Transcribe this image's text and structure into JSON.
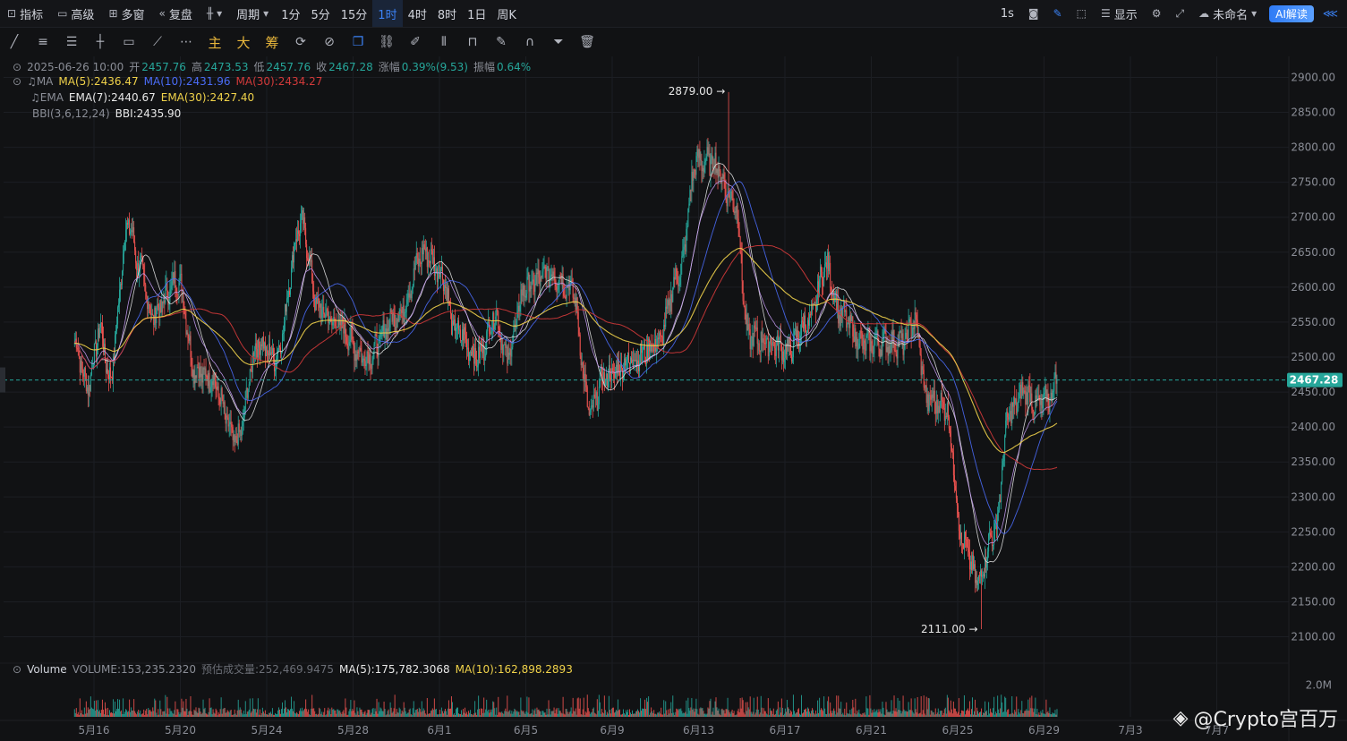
{
  "toolbar": {
    "indicators": "指标",
    "advanced": "高级",
    "multi_window": "多窗",
    "replay": "复盘",
    "period": "周期",
    "timeframes": [
      "1分",
      "5分",
      "15分",
      "1时",
      "4时",
      "8时",
      "1日",
      "周K"
    ],
    "active_timeframe": "1时",
    "interval_1s": "1s",
    "display": "显示",
    "unnamed": "未命名",
    "ai": "AI解读"
  },
  "drawing_tools": {
    "main": "主",
    "big": "大",
    "chip": "筹"
  },
  "legend": {
    "ohlc": {
      "date": "2025-06-26 10:00",
      "open_label": "开",
      "open": "2457.76",
      "high_label": "高",
      "high": "2473.53",
      "low_label": "低",
      "low": "2457.76",
      "close_label": "收",
      "close": "2467.28",
      "change_label": "涨幅",
      "change": "0.39%(9.53)",
      "amp_label": "振幅",
      "amp": "0.64%"
    },
    "ma": {
      "name": "MA",
      "ma5": "MA(5):2436.47",
      "ma10": "MA(10):2431.96",
      "ma30": "MA(30):2434.27"
    },
    "ema": {
      "name": "EMA",
      "ema7": "EMA(7):2440.67",
      "ema30": "EMA(30):2427.40"
    },
    "bbi": {
      "name": "BBI(3,6,12,24)",
      "value": "BBI:2435.90"
    },
    "volume": {
      "name": "Volume",
      "vol": "VOLUME:153,235.2320",
      "est": "预估成交量:252,469.9475",
      "ma5": "MA(5):175,782.3068",
      "ma10": "MA(10):162,898.2893"
    }
  },
  "colors": {
    "up": "#26a69a",
    "down": "#ef5350",
    "ma5": "#f0d24a",
    "ma10": "#4a6cf7",
    "ma30": "#d33a3a",
    "ema": "#e8e8e8",
    "bbi": "#c79df5",
    "bg": "#111214",
    "grid": "#1c1e23",
    "price_tag": "#26a69a"
  },
  "chart_data": {
    "type": "candlestick",
    "interval": "1h",
    "price_axis": {
      "ylim": [
        2070,
        2930
      ],
      "ticks": [
        2100,
        2150,
        2200,
        2250,
        2300,
        2350,
        2400,
        2450,
        2500,
        2550,
        2600,
        2650,
        2700,
        2750,
        2800,
        2850,
        2900
      ]
    },
    "volume_axis": {
      "tick_label": "2.0M",
      "tick_value": 2000000,
      "ymax": 2700000
    },
    "x_tick_labels": [
      "5月16",
      "5月20",
      "5月24",
      "5月28",
      "6月1",
      "6月5",
      "6月9",
      "6月13",
      "6月17",
      "6月21",
      "6月25",
      "6月29",
      "7月3",
      "7月7"
    ],
    "x_days_per_label": 4,
    "series_anchors": [
      {
        "d": 0,
        "p": 2520
      },
      {
        "d": 0.6,
        "p": 2460
      },
      {
        "d": 1.2,
        "p": 2540
      },
      {
        "d": 1.6,
        "p": 2470
      },
      {
        "d": 2.5,
        "p": 2690
      },
      {
        "d": 3.0,
        "p": 2630
      },
      {
        "d": 3.6,
        "p": 2560
      },
      {
        "d": 4.8,
        "p": 2610
      },
      {
        "d": 5.6,
        "p": 2480
      },
      {
        "d": 6.3,
        "p": 2470
      },
      {
        "d": 7.5,
        "p": 2380
      },
      {
        "d": 8.5,
        "p": 2520
      },
      {
        "d": 9.3,
        "p": 2500
      },
      {
        "d": 10.5,
        "p": 2690
      },
      {
        "d": 11.3,
        "p": 2570
      },
      {
        "d": 12.0,
        "p": 2550
      },
      {
        "d": 13.5,
        "p": 2500
      },
      {
        "d": 15.0,
        "p": 2560
      },
      {
        "d": 16.2,
        "p": 2650
      },
      {
        "d": 17.0,
        "p": 2620
      },
      {
        "d": 17.6,
        "p": 2540
      },
      {
        "d": 18.7,
        "p": 2500
      },
      {
        "d": 19.5,
        "p": 2560
      },
      {
        "d": 20.0,
        "p": 2500
      },
      {
        "d": 20.9,
        "p": 2600
      },
      {
        "d": 22.0,
        "p": 2620
      },
      {
        "d": 23.0,
        "p": 2600
      },
      {
        "d": 23.9,
        "p": 2420
      },
      {
        "d": 24.5,
        "p": 2470
      },
      {
        "d": 26.0,
        "p": 2500
      },
      {
        "d": 27.0,
        "p": 2520
      },
      {
        "d": 28.0,
        "p": 2620
      },
      {
        "d": 28.8,
        "p": 2780
      },
      {
        "d": 29.5,
        "p": 2780
      },
      {
        "d": 30.6,
        "p": 2720
      },
      {
        "d": 31.2,
        "p": 2530
      },
      {
        "d": 32.3,
        "p": 2520
      },
      {
        "d": 33.0,
        "p": 2510
      },
      {
        "d": 34.0,
        "p": 2550
      },
      {
        "d": 34.8,
        "p": 2630
      },
      {
        "d": 35.5,
        "p": 2560
      },
      {
        "d": 36.5,
        "p": 2520
      },
      {
        "d": 37.5,
        "p": 2520
      },
      {
        "d": 38.4,
        "p": 2520
      },
      {
        "d": 38.9,
        "p": 2550
      },
      {
        "d": 39.5,
        "p": 2440
      },
      {
        "d": 40.3,
        "p": 2430
      },
      {
        "d": 41.2,
        "p": 2230
      },
      {
        "d": 41.8,
        "p": 2180
      },
      {
        "d": 42.6,
        "p": 2250
      },
      {
        "d": 43.3,
        "p": 2420
      },
      {
        "d": 44.0,
        "p": 2450
      },
      {
        "d": 44.6,
        "p": 2430
      },
      {
        "d": 45.1,
        "p": 2440
      },
      {
        "d": 45.5,
        "p": 2467.28
      }
    ],
    "annotations": [
      {
        "label": "2879.00",
        "price": 2879.0,
        "day": 30.3,
        "kind": "high"
      },
      {
        "label": "2111.00",
        "price": 2111.0,
        "day": 42.0,
        "kind": "low"
      }
    ],
    "last_price": {
      "label": "2467.28",
      "price": 2467.28
    }
  },
  "watermark": "@Crypto宫百万"
}
